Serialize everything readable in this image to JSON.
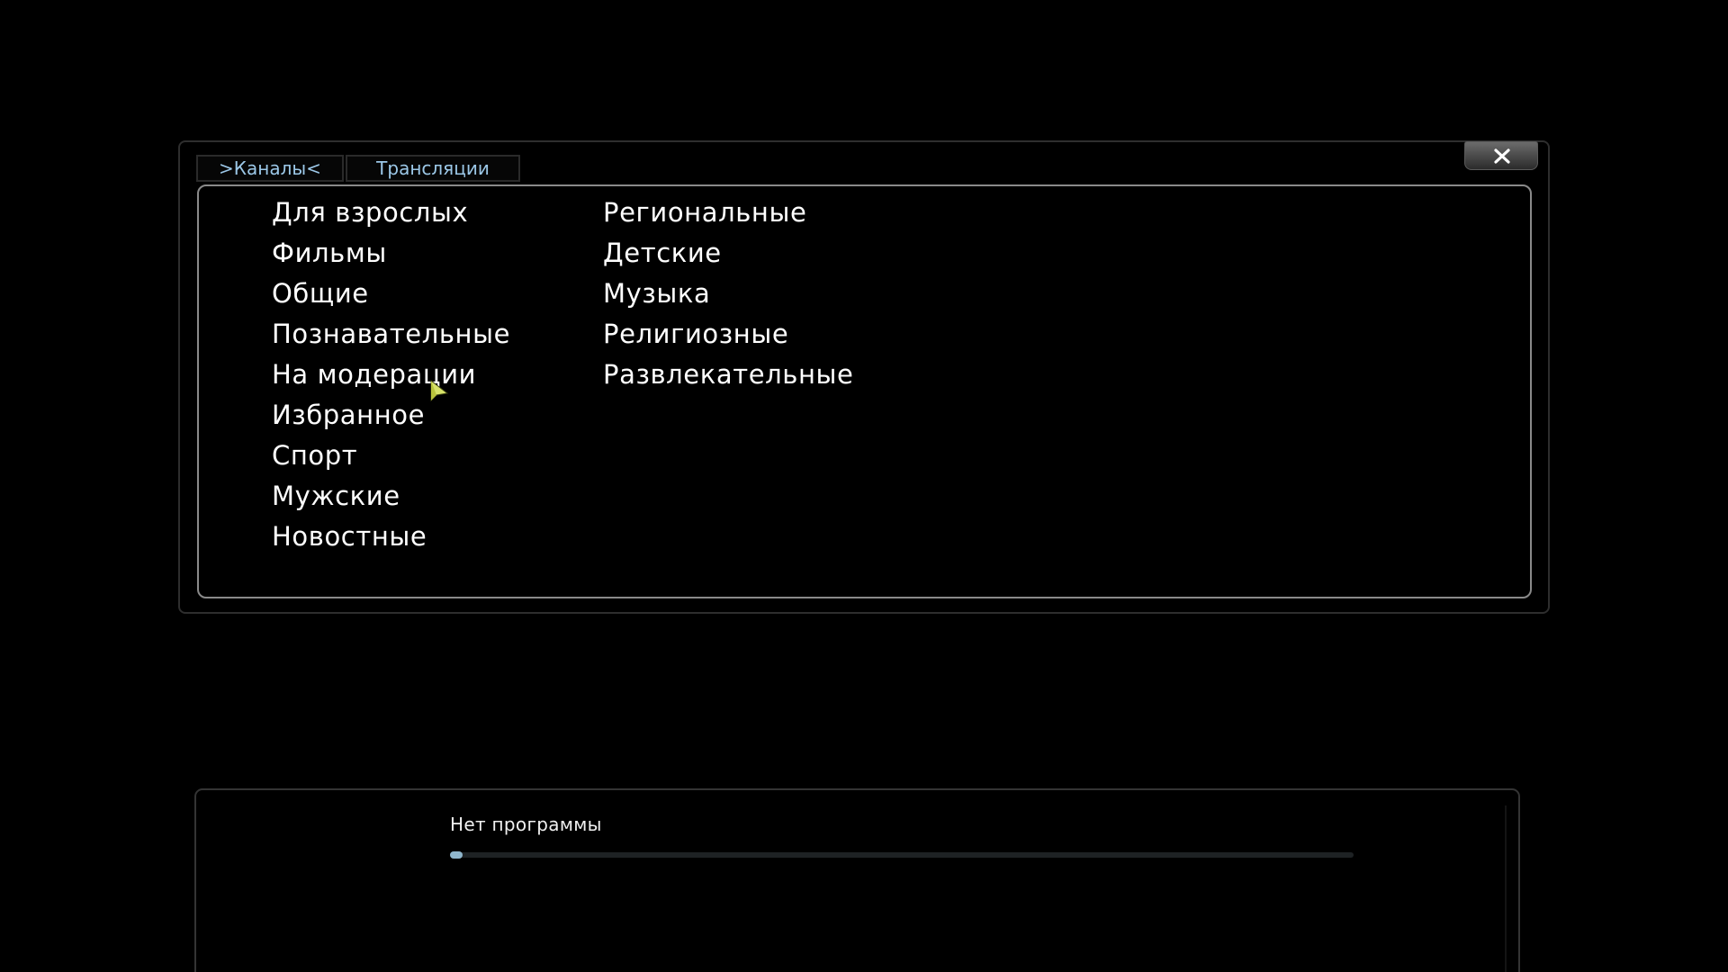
{
  "tabs": [
    {
      "label": ">Каналы<",
      "active": true
    },
    {
      "label": "Трансляции",
      "active": false
    }
  ],
  "close_button": {
    "icon": "close-icon"
  },
  "categories": {
    "column1": [
      "Для взрослых",
      "Фильмы",
      "Общие",
      "Познавательные",
      "На модерации",
      "Избранное",
      "Спорт",
      "Мужские",
      "Новостные"
    ],
    "column2": [
      "Региональные",
      "Детские",
      "Музыка",
      "Религиозные",
      "Развлекательные"
    ],
    "selected": "На модерации"
  },
  "program_info": {
    "title": "Нет программы",
    "progress": 0.01
  },
  "colors": {
    "tab_text": "#9cc8e8",
    "highlight": "#5aa0f0",
    "background": "#000000"
  }
}
